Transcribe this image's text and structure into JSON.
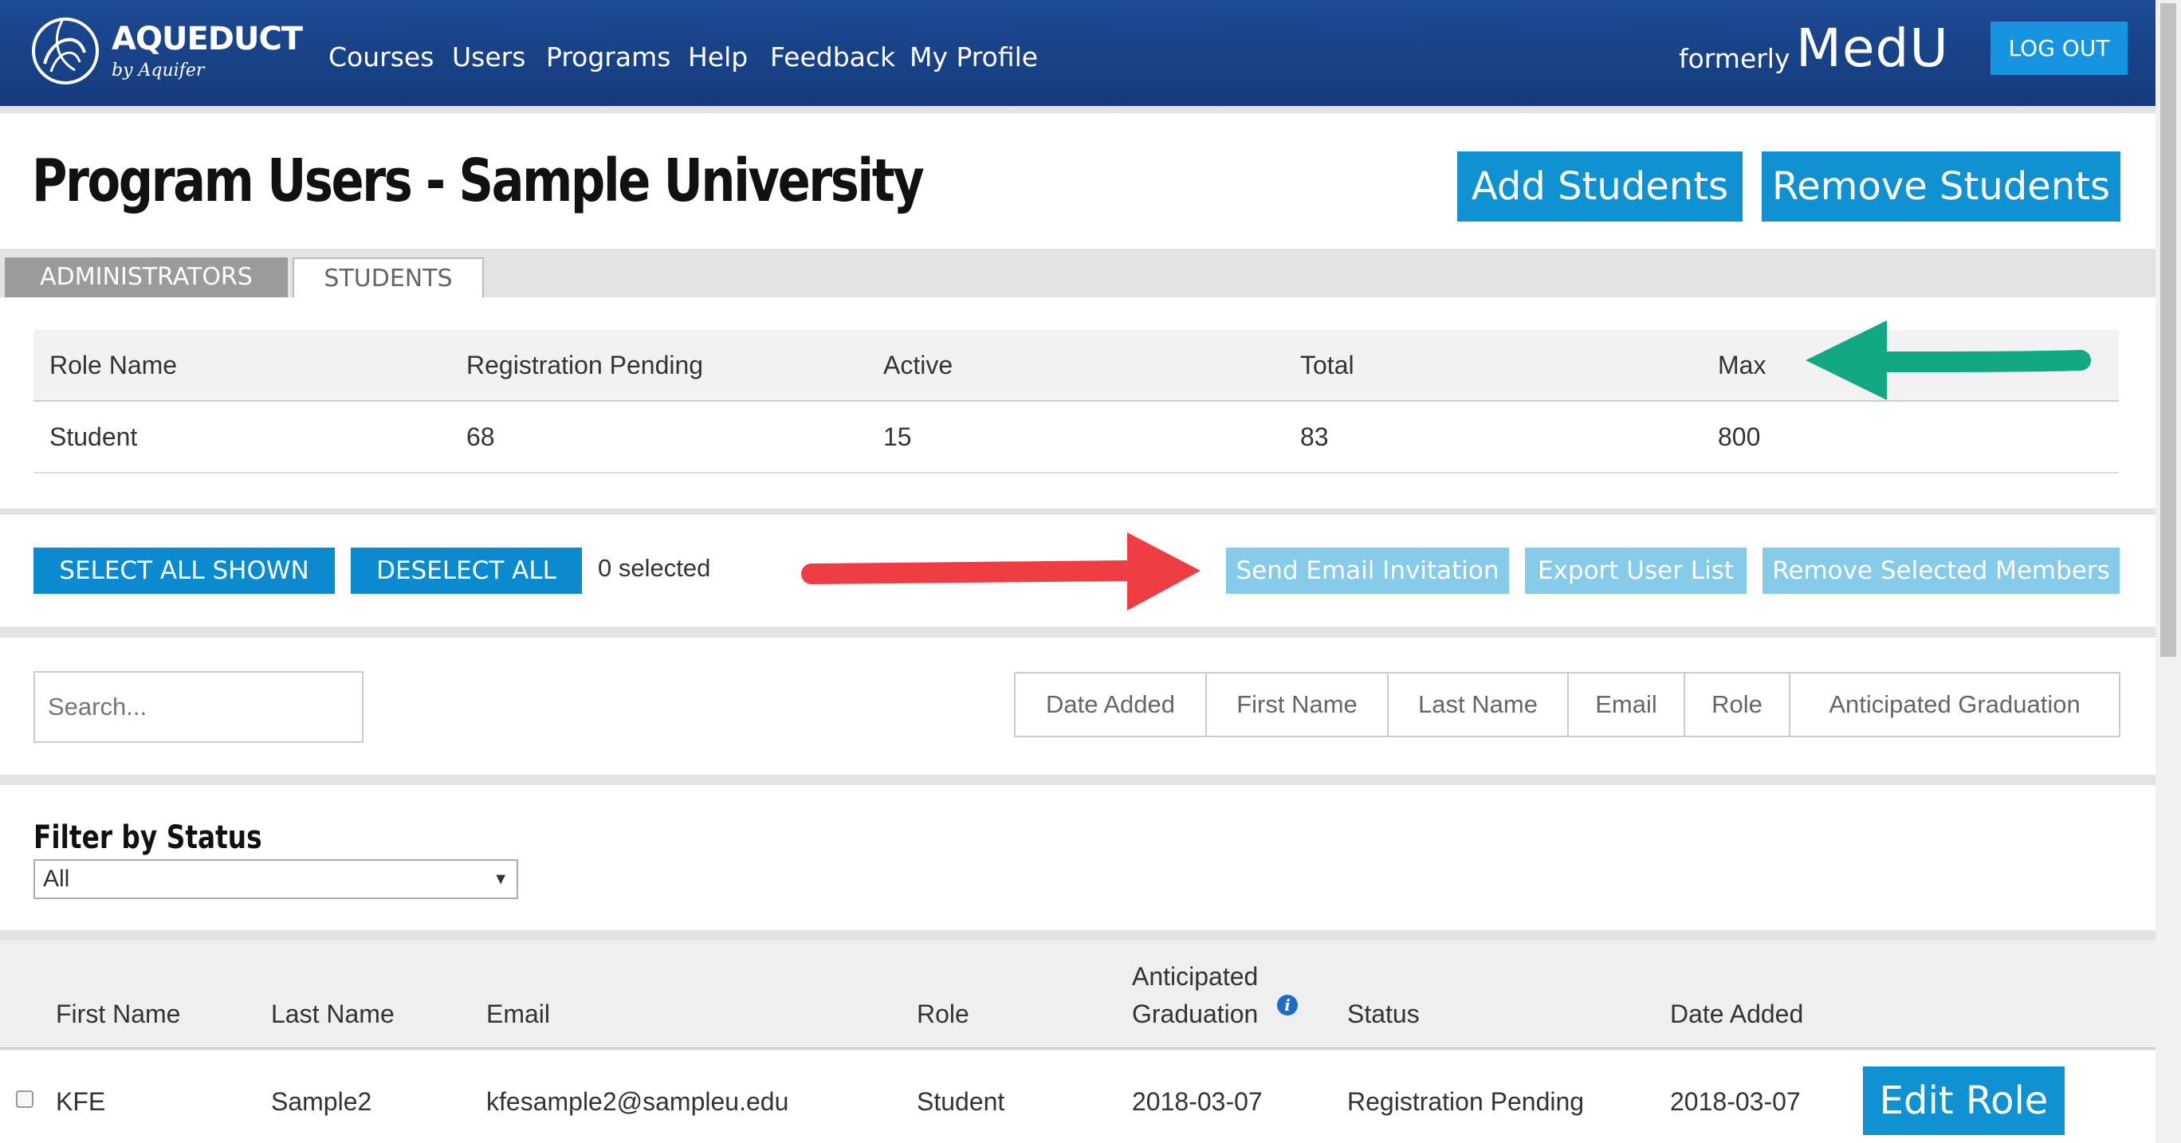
{
  "navbar": {
    "logo_title": "AQUEDUCT",
    "logo_subtitle": "by Aquifer",
    "items": [
      "Courses",
      "Users",
      "Programs",
      "Help",
      "Feedback",
      "My Profile"
    ],
    "formerly": "formerly",
    "medu": "MedU",
    "logout": "LOG OUT"
  },
  "header": {
    "title": "Program Users - Sample University",
    "add_students": "Add Students",
    "remove_students": "Remove Students"
  },
  "tabs": [
    "ADMINISTRATORS",
    "STUDENTS"
  ],
  "summary": {
    "columns": [
      "Role Name",
      "Registration Pending",
      "Active",
      "Total",
      "Max"
    ],
    "rows": [
      [
        "Student",
        "68",
        "15",
        "83",
        "800"
      ]
    ]
  },
  "actions": {
    "select_all": "SELECT ALL SHOWN",
    "deselect_all": "DESELECT ALL",
    "selected_count": "0 selected",
    "send_email": "Send Email Invitation",
    "export_list": "Export User List",
    "remove_selected": "Remove Selected Members"
  },
  "search": {
    "placeholder": "Search..."
  },
  "sort_options": [
    "Date Added",
    "First Name",
    "Last Name",
    "Email",
    "Role",
    "Anticipated Graduation"
  ],
  "filter": {
    "label": "Filter by Status",
    "selected": "All"
  },
  "users_table": {
    "columns": [
      "First Name",
      "Last Name",
      "Email",
      "Role",
      "Anticipated",
      "Graduation",
      "Status",
      "Date Added"
    ],
    "rows": [
      {
        "first": "KFE",
        "last": "Sample2",
        "email": "kfesample2@sampleu.edu",
        "role": "Student",
        "graduation": "2018-03-07",
        "status": "Registration Pending",
        "date_added": "2018-03-07",
        "edit": "Edit Role"
      }
    ]
  },
  "colors": {
    "navbar": "#1a4488",
    "primary_button": "#0f91d2",
    "disabled_button": "#86cbe9",
    "green_arrow": "#12a884",
    "red_arrow": "#ee3d43"
  }
}
